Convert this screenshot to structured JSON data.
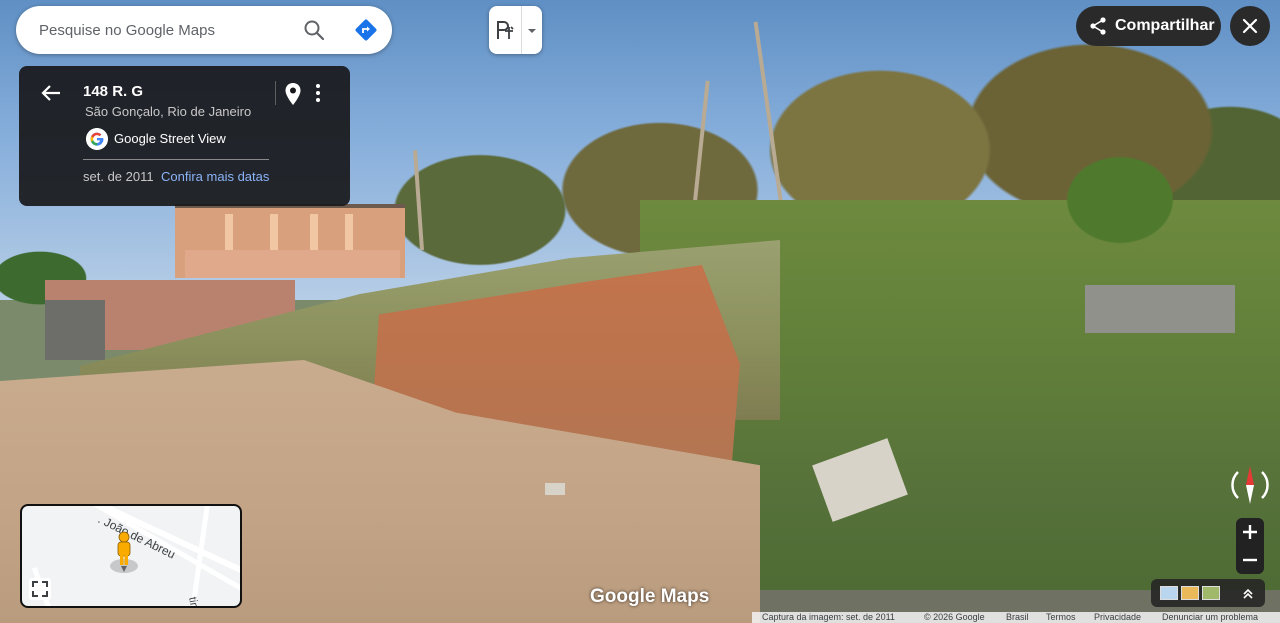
{
  "search": {
    "placeholder": "Pesquise no Google Maps",
    "search_icon": "search-icon",
    "directions_icon": "directions-icon"
  },
  "pegman": {
    "icon": "pegman-icon"
  },
  "share": {
    "label": "Compartilhar",
    "icon": "share-icon"
  },
  "close": {
    "icon": "close-icon"
  },
  "info_card": {
    "title": "148 R. G",
    "subtitle": "São Gonçalo, Rio de Janeiro",
    "source": "Google Street View",
    "capture_date": "set. de 2011",
    "more_dates": "Confira mais datas"
  },
  "minimap": {
    "street_label": ". João de Abreu",
    "side_label": "timore"
  },
  "logo": "Google Maps",
  "footer": {
    "capture": "Captura da imagem: set. de 2011",
    "copyright": "© 2026 Google",
    "region": "Brasil",
    "terms": "Termos",
    "privacy": "Privacidade",
    "report": "Denunciar um problema"
  },
  "colors": {
    "card_bg": "#18181a",
    "link": "#8ab4f8",
    "directions": "#1a73e8",
    "compass_red": "#e53935"
  }
}
